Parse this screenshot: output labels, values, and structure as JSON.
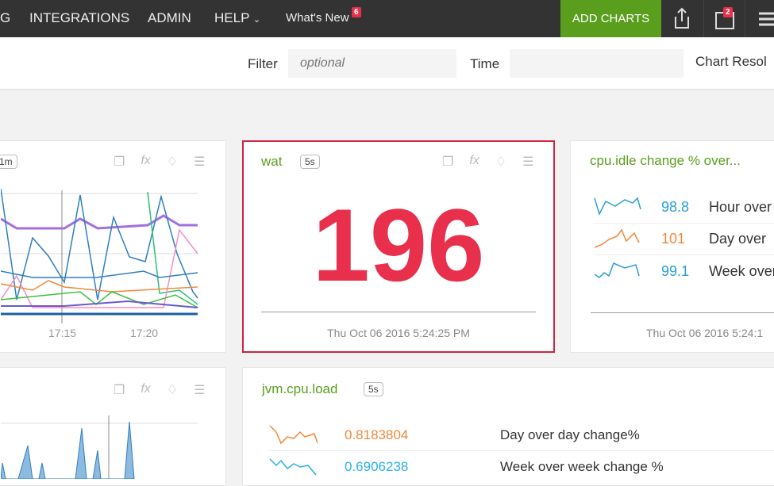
{
  "nav": {
    "items": [
      "G",
      "INTEGRATIONS",
      "ADMIN",
      "HELP"
    ],
    "whats_new": "What's New",
    "whats_new_badge": "6",
    "add_charts": "ADD CHARTS",
    "notifications_badge": "2"
  },
  "filterbar": {
    "filter_label": "Filter",
    "filter_placeholder": "optional",
    "time_label": "Time",
    "time_value": "",
    "chart_resolution_label": "Chart Resol"
  },
  "colors": {
    "accent": "#5a9e1d",
    "alert": "#e8304c",
    "blue": "#2a9fd6",
    "orange": "#f0883a"
  },
  "cards": {
    "c1": {
      "resolution": "1m",
      "ticks": [
        "17:15",
        "17:20"
      ]
    },
    "c2": {
      "title": "wat",
      "resolution": "5s",
      "value": "196",
      "timestamp": "Thu Oct 06 2016 5:24:25 PM"
    },
    "c3": {
      "title": "cpu.idle change % over...",
      "rows": [
        {
          "value": "98.8",
          "label": "Hour over",
          "color": "blue"
        },
        {
          "value": "101",
          "label": "Day over",
          "color": "orange"
        },
        {
          "value": "99.1",
          "label": "Week over",
          "color": "blue"
        }
      ],
      "timestamp": "Thu Oct 06 2016 5:24:1"
    },
    "c5": {
      "title": "jvm.cpu.load",
      "resolution": "5s",
      "rows": [
        {
          "value": "0.8183804",
          "label": "Day over day change%",
          "color": "orange"
        },
        {
          "value": "0.6906238",
          "label": "Week over week change %",
          "color": "blue"
        }
      ]
    }
  }
}
